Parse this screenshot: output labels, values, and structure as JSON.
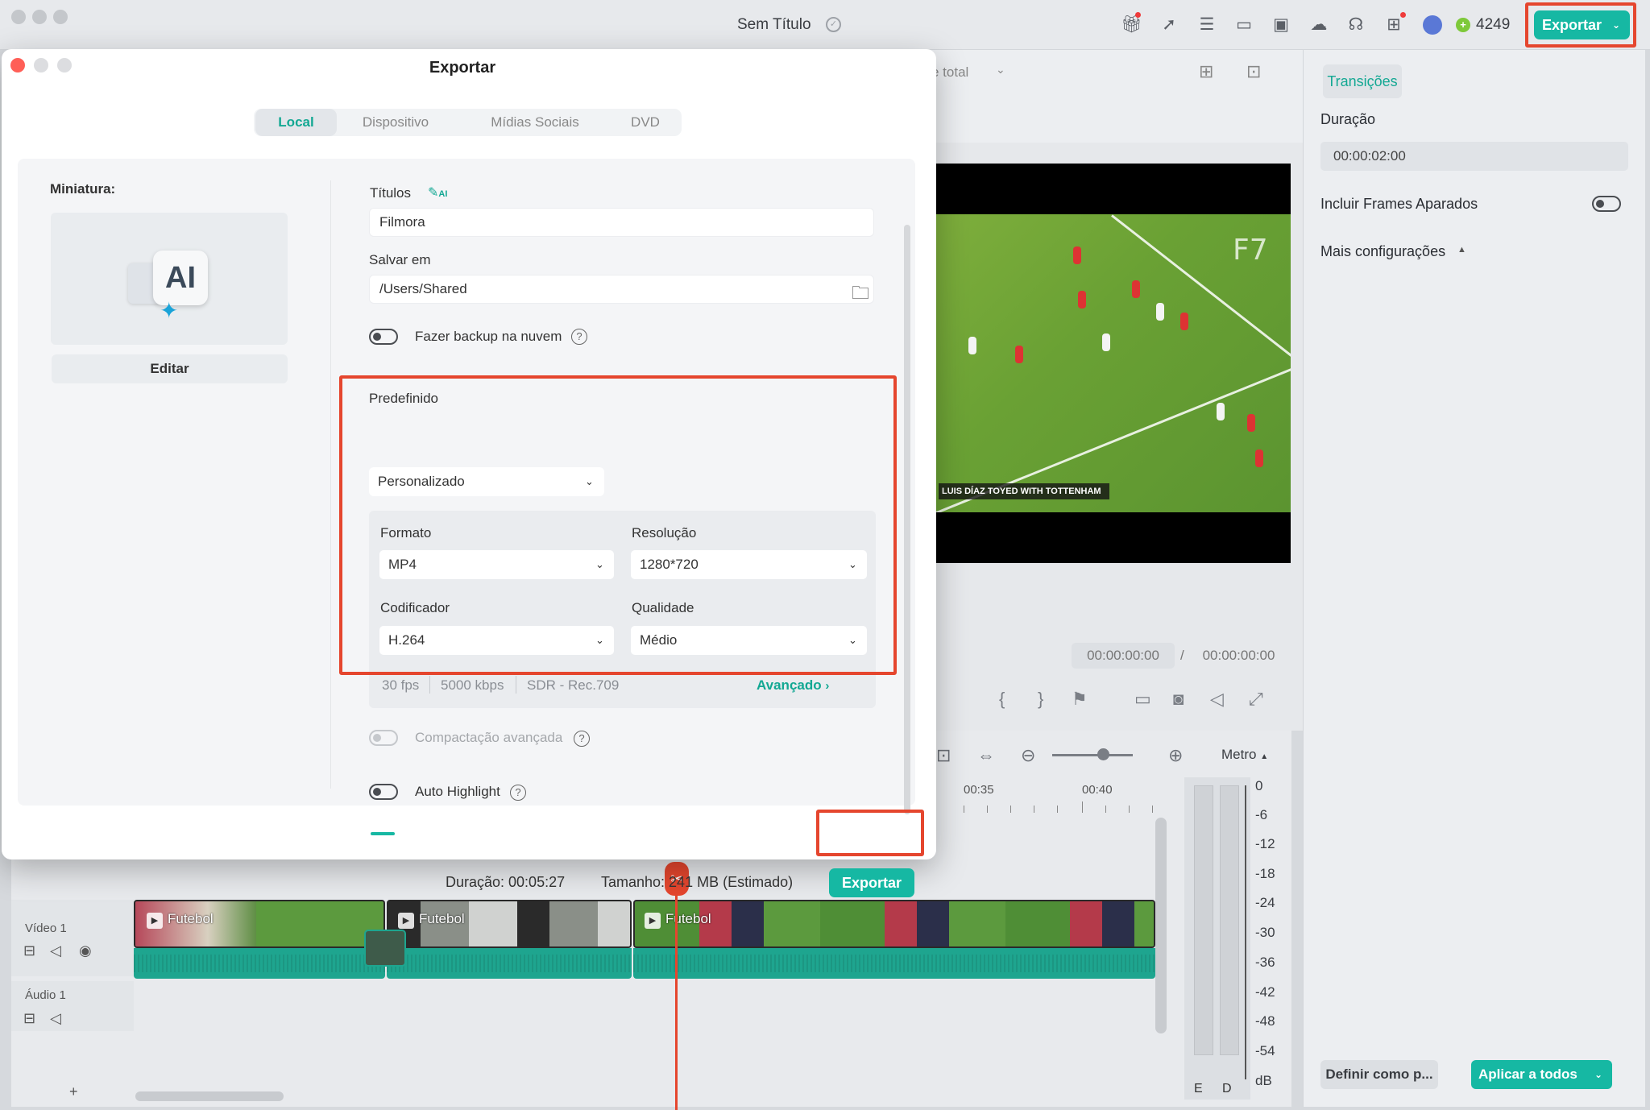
{
  "app": {
    "title": "Sem Título",
    "credits": "4249",
    "export_label": "Exportar",
    "top_icons": [
      "gift-icon",
      "send-icon",
      "tasks-icon",
      "layout-icon",
      "save-icon",
      "cloud-icon",
      "headset-icon",
      "apps-icon"
    ]
  },
  "right_panel": {
    "tab": "Transições",
    "duration_label": "Duração",
    "duration_value": "00:00:02:00",
    "include_frames_label": "Incluir Frames Aparados",
    "more_settings_label": "Mais configurações",
    "set_default_label": "Definir como p...",
    "apply_all_label": "Aplicar a todos"
  },
  "preview": {
    "dropdown_partial": "e total",
    "caption": "LUIS DÍAZ TOYED WITH TOTTENHAM",
    "logo": "F7",
    "timecode_current": "00:00:00:00",
    "timecode_separator": "/",
    "timecode_total": "00:00:00:00"
  },
  "timeline": {
    "meter_label": "Metro",
    "ruler": [
      "00:35",
      "00:40"
    ],
    "tracks": [
      {
        "label": "Vídeo 1"
      },
      {
        "label": "Áudio 1"
      }
    ],
    "clips": [
      {
        "label": "Futebol"
      },
      {
        "label": "Futebol"
      },
      {
        "label": "Futebol"
      }
    ],
    "meter_scale": [
      "0",
      "-6",
      "-12",
      "-18",
      "-24",
      "-30",
      "-36",
      "-42",
      "-48",
      "-54",
      "dB"
    ],
    "meter_channels": [
      "E",
      "D"
    ],
    "add_track": "+"
  },
  "dialog": {
    "title": "Exportar",
    "tabs": [
      {
        "label": "Local",
        "active": true
      },
      {
        "label": "Dispositivo",
        "active": false
      },
      {
        "label": "Mídias Sociais",
        "active": false
      },
      {
        "label": "DVD",
        "active": false
      }
    ],
    "thumbnail_label": "Miniatura:",
    "thumbnail_ai_text": "AI",
    "edit_label": "Editar",
    "titles_label": "Títulos",
    "ai_badge": "AI",
    "title_value": "Filmora",
    "save_in_label": "Salvar em",
    "save_path": "/Users/Shared",
    "cloud_backup_label": "Fazer backup na nuvem",
    "preset_label": "Predefinido",
    "preset_value": "Personalizado",
    "format_label": "Formato",
    "format_value": "MP4",
    "resolution_label": "Resolução",
    "resolution_value": "1280*720",
    "encoder_label": "Codificador",
    "encoder_value": "H.264",
    "quality_label": "Qualidade",
    "quality_value": "Médio",
    "specs": [
      "30 fps",
      "5000 kbps",
      "SDR - Rec.709"
    ],
    "advanced_label": "Avançado",
    "advanced_compression_label": "Compactação avançada",
    "auto_highlight_label": "Auto Highlight",
    "duration_text": "Duração: 00:05:27",
    "size_text": "Tamanho: 241 MB (Estimado)",
    "export_label": "Exportar"
  },
  "colors": {
    "accent": "#16b8a3",
    "highlight": "#e5462e"
  }
}
